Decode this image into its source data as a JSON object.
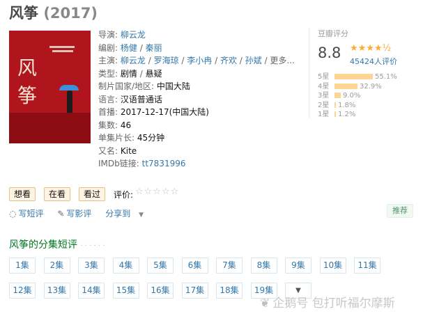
{
  "title": {
    "name": "风筝",
    "year": "(2017)"
  },
  "info": [
    {
      "label": "导演",
      "parts": [
        {
          "t": "柳云龙",
          "link": true
        }
      ]
    },
    {
      "label": "编剧",
      "parts": [
        {
          "t": "杨健",
          "link": true
        },
        {
          "t": " / ",
          "link": false
        },
        {
          "t": "秦丽",
          "link": true
        }
      ]
    },
    {
      "label": "主演",
      "parts": [
        {
          "t": "柳云龙",
          "link": true
        },
        {
          "t": " / ",
          "link": false
        },
        {
          "t": "罗海琼",
          "link": true
        },
        {
          "t": " / ",
          "link": false
        },
        {
          "t": "李小冉",
          "link": true
        },
        {
          "t": " / ",
          "link": false
        },
        {
          "t": "齐欢",
          "link": true
        },
        {
          "t": " / ",
          "link": false
        },
        {
          "t": "孙斌",
          "link": true
        },
        {
          "t": " / 更多...",
          "link": false
        }
      ]
    },
    {
      "label": "类型",
      "parts": [
        {
          "t": "剧情",
          "link": false
        },
        {
          "t": " / ",
          "link": false
        },
        {
          "t": "悬疑",
          "link": false
        }
      ]
    },
    {
      "label": "制片国家/地区",
      "parts": [
        {
          "t": "中国大陆",
          "link": false
        }
      ]
    },
    {
      "label": "语言",
      "parts": [
        {
          "t": "汉语普通话",
          "link": false
        }
      ]
    },
    {
      "label": "首播",
      "parts": [
        {
          "t": "2017-12-17(中国大陆)",
          "link": false
        }
      ]
    },
    {
      "label": "集数",
      "parts": [
        {
          "t": "46",
          "link": false
        }
      ]
    },
    {
      "label": "单集片长",
      "parts": [
        {
          "t": "45分钟",
          "link": false
        }
      ]
    },
    {
      "label": "又名",
      "parts": [
        {
          "t": "Kite",
          "link": false
        }
      ]
    },
    {
      "label": "IMDb链接",
      "parts": [
        {
          "t": "tt7831996",
          "link": true
        }
      ]
    }
  ],
  "rating": {
    "header": "豆瓣评分",
    "score": "8.8",
    "stars": "★★★★½",
    "count": "45424人评价",
    "bars": [
      {
        "label": "5星",
        "pct": "55.1%",
        "value": 0.551
      },
      {
        "label": "4星",
        "pct": "32.9%",
        "value": 0.329
      },
      {
        "label": "3星",
        "pct": "9.0%",
        "value": 0.09
      },
      {
        "label": "2星",
        "pct": "1.8%",
        "value": 0.018
      },
      {
        "label": "1星",
        "pct": "1.2%",
        "value": 0.012
      }
    ]
  },
  "marks": {
    "want": "想看",
    "watching": "在看",
    "watched": "看过",
    "rate_label": "评价:",
    "rate_stars": "☆☆☆☆☆"
  },
  "actions": {
    "short_review": "写短评",
    "review": "写影评",
    "share": "分享到",
    "recommend": "推荐"
  },
  "episodes_section": {
    "title": "风筝的分集短评",
    "dots": "· · · · · ·",
    "episodes": [
      "1集",
      "2集",
      "3集",
      "4集",
      "5集",
      "6集",
      "7集",
      "8集",
      "9集",
      "10集",
      "11集",
      "12集",
      "13集",
      "14集",
      "15集",
      "16集",
      "17集",
      "18集",
      "19集"
    ],
    "more": "▼"
  },
  "watermark": "企鹅号 包打听福尔摩斯"
}
